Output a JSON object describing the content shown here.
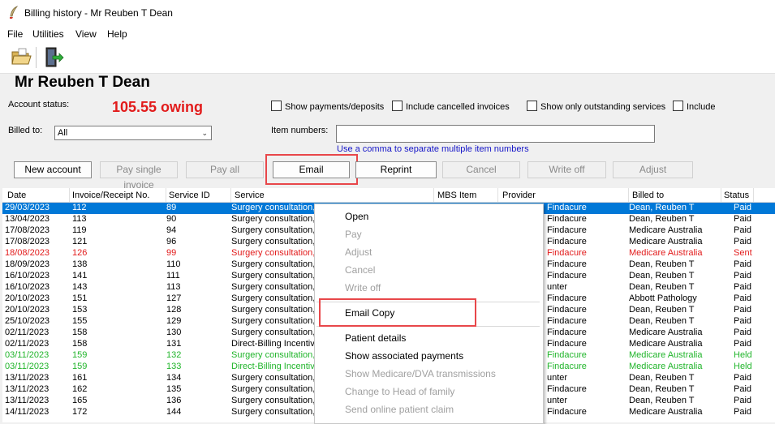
{
  "window": {
    "title": "Billing history - Mr Reuben T Dean"
  },
  "menu": [
    "File",
    "Utilities",
    "View",
    "Help"
  ],
  "patient": {
    "name": "Mr Reuben T Dean"
  },
  "account": {
    "status_label": "Account status:",
    "owing": "105.55 owing",
    "billed_to_label": "Billed to:",
    "billed_to_value": "All",
    "item_numbers_label": "Item numbers:",
    "item_numbers_value": "",
    "hint": "Use a comma to separate multiple item numbers"
  },
  "checkboxes": [
    "Show payments/deposits",
    "Include cancelled invoices",
    "Show only outstanding services",
    "Include"
  ],
  "buttons": {
    "new_account": "New account",
    "pay_single": "Pay single invoice",
    "pay_all": "Pay all",
    "email": "Email",
    "reprint": "Reprint",
    "cancel": "Cancel",
    "write_off": "Write off",
    "adjust": "Adjust"
  },
  "columns": [
    "Date",
    "Invoice/Receipt No.",
    "Service ID",
    "Service",
    "MBS Item",
    "Provider",
    "Billed to",
    "Status"
  ],
  "rows": [
    {
      "date": "29/03/2023",
      "inv": "112",
      "sid": "89",
      "service": "Surgery consultation,",
      "provider": "Findacure",
      "billed": "Dean, Reuben T",
      "status": "Paid",
      "style": "selected"
    },
    {
      "date": "13/04/2023",
      "inv": "113",
      "sid": "90",
      "service": "Surgery consultation,",
      "provider": "Findacure",
      "billed": "Dean, Reuben T",
      "status": "Paid",
      "style": ""
    },
    {
      "date": "17/08/2023",
      "inv": "119",
      "sid": "94",
      "service": "Surgery consultation,",
      "provider": "Findacure",
      "billed": "Medicare Australia",
      "status": "Paid",
      "style": ""
    },
    {
      "date": "17/08/2023",
      "inv": "121",
      "sid": "96",
      "service": "Surgery consultation,",
      "provider": "Findacure",
      "billed": "Medicare Australia",
      "status": "Paid",
      "style": ""
    },
    {
      "date": "18/08/2023",
      "inv": "126",
      "sid": "99",
      "service": "Surgery consultation,",
      "provider": "Findacure",
      "billed": "Medicare Australia",
      "status": "Sent",
      "style": "red"
    },
    {
      "date": "18/09/2023",
      "inv": "138",
      "sid": "110",
      "service": "Surgery consultation,",
      "provider": "Findacure",
      "billed": "Dean, Reuben T",
      "status": "Paid",
      "style": ""
    },
    {
      "date": "16/10/2023",
      "inv": "141",
      "sid": "111",
      "service": "Surgery consultation,",
      "provider": "Findacure",
      "billed": "Dean, Reuben T",
      "status": "Paid",
      "style": ""
    },
    {
      "date": "16/10/2023",
      "inv": "143",
      "sid": "113",
      "service": "Surgery consultation,",
      "provider": "unter",
      "billed": "Dean, Reuben T",
      "status": "Paid",
      "style": ""
    },
    {
      "date": "20/10/2023",
      "inv": "151",
      "sid": "127",
      "service": "Surgery consultation,",
      "provider": "Findacure",
      "billed": "Abbott Pathology",
      "status": "Paid",
      "style": ""
    },
    {
      "date": "20/10/2023",
      "inv": "153",
      "sid": "128",
      "service": "Surgery consultation,",
      "provider": "Findacure",
      "billed": "Dean, Reuben T",
      "status": "Paid",
      "style": ""
    },
    {
      "date": "25/10/2023",
      "inv": "155",
      "sid": "129",
      "service": "Surgery consultation,",
      "provider": "Findacure",
      "billed": "Dean, Reuben T",
      "status": "Paid",
      "style": ""
    },
    {
      "date": "02/11/2023",
      "inv": "158",
      "sid": "130",
      "service": "Surgery consultation,",
      "provider": "Findacure",
      "billed": "Medicare Australia",
      "status": "Paid",
      "style": ""
    },
    {
      "date": "02/11/2023",
      "inv": "158",
      "sid": "131",
      "service": "Direct-Billing Incentive",
      "provider": "Findacure",
      "billed": "Medicare Australia",
      "status": "Paid",
      "style": ""
    },
    {
      "date": "03/11/2023",
      "inv": "159",
      "sid": "132",
      "service": "Surgery consultation,",
      "provider": "Findacure",
      "billed": "Medicare Australia",
      "status": "Held",
      "style": "green"
    },
    {
      "date": "03/11/2023",
      "inv": "159",
      "sid": "133",
      "service": "Direct-Billing Incentive",
      "provider": "Findacure",
      "billed": "Medicare Australia",
      "status": "Held",
      "style": "green"
    },
    {
      "date": "13/11/2023",
      "inv": "161",
      "sid": "134",
      "service": "Surgery consultation,",
      "provider": "unter",
      "billed": "Dean, Reuben T",
      "status": "Paid",
      "style": ""
    },
    {
      "date": "13/11/2023",
      "inv": "162",
      "sid": "135",
      "service": "Surgery consultation,",
      "provider": "Findacure",
      "billed": "Dean, Reuben T",
      "status": "Paid",
      "style": ""
    },
    {
      "date": "13/11/2023",
      "inv": "165",
      "sid": "136",
      "service": "Surgery consultation,",
      "provider": "unter",
      "billed": "Dean, Reuben T",
      "status": "Paid",
      "style": ""
    },
    {
      "date": "14/11/2023",
      "inv": "172",
      "sid": "144",
      "service": "Surgery consultation,",
      "provider": "Findacure",
      "billed": "Medicare Australia",
      "status": "Paid",
      "style": ""
    }
  ],
  "context_menu": {
    "items": [
      {
        "label": "Open",
        "enabled": true
      },
      {
        "label": "Pay",
        "enabled": false
      },
      {
        "label": "Adjust",
        "enabled": false
      },
      {
        "label": "Cancel",
        "enabled": false
      },
      {
        "label": "Write off",
        "enabled": false
      },
      {
        "label": "Email Copy",
        "enabled": true
      },
      {
        "label": "Patient details",
        "enabled": true
      },
      {
        "label": "Show associated payments",
        "enabled": true
      },
      {
        "label": "Show Medicare/DVA transmissions",
        "enabled": false
      },
      {
        "label": "Change to Head of family",
        "enabled": false
      },
      {
        "label": "Send online patient claim",
        "enabled": false
      }
    ]
  },
  "colors": {
    "highlight": "#e8474a",
    "selection": "#0078d7",
    "owing": "#e21b1b",
    "held": "#21b52b",
    "hint": "#1515c8"
  }
}
